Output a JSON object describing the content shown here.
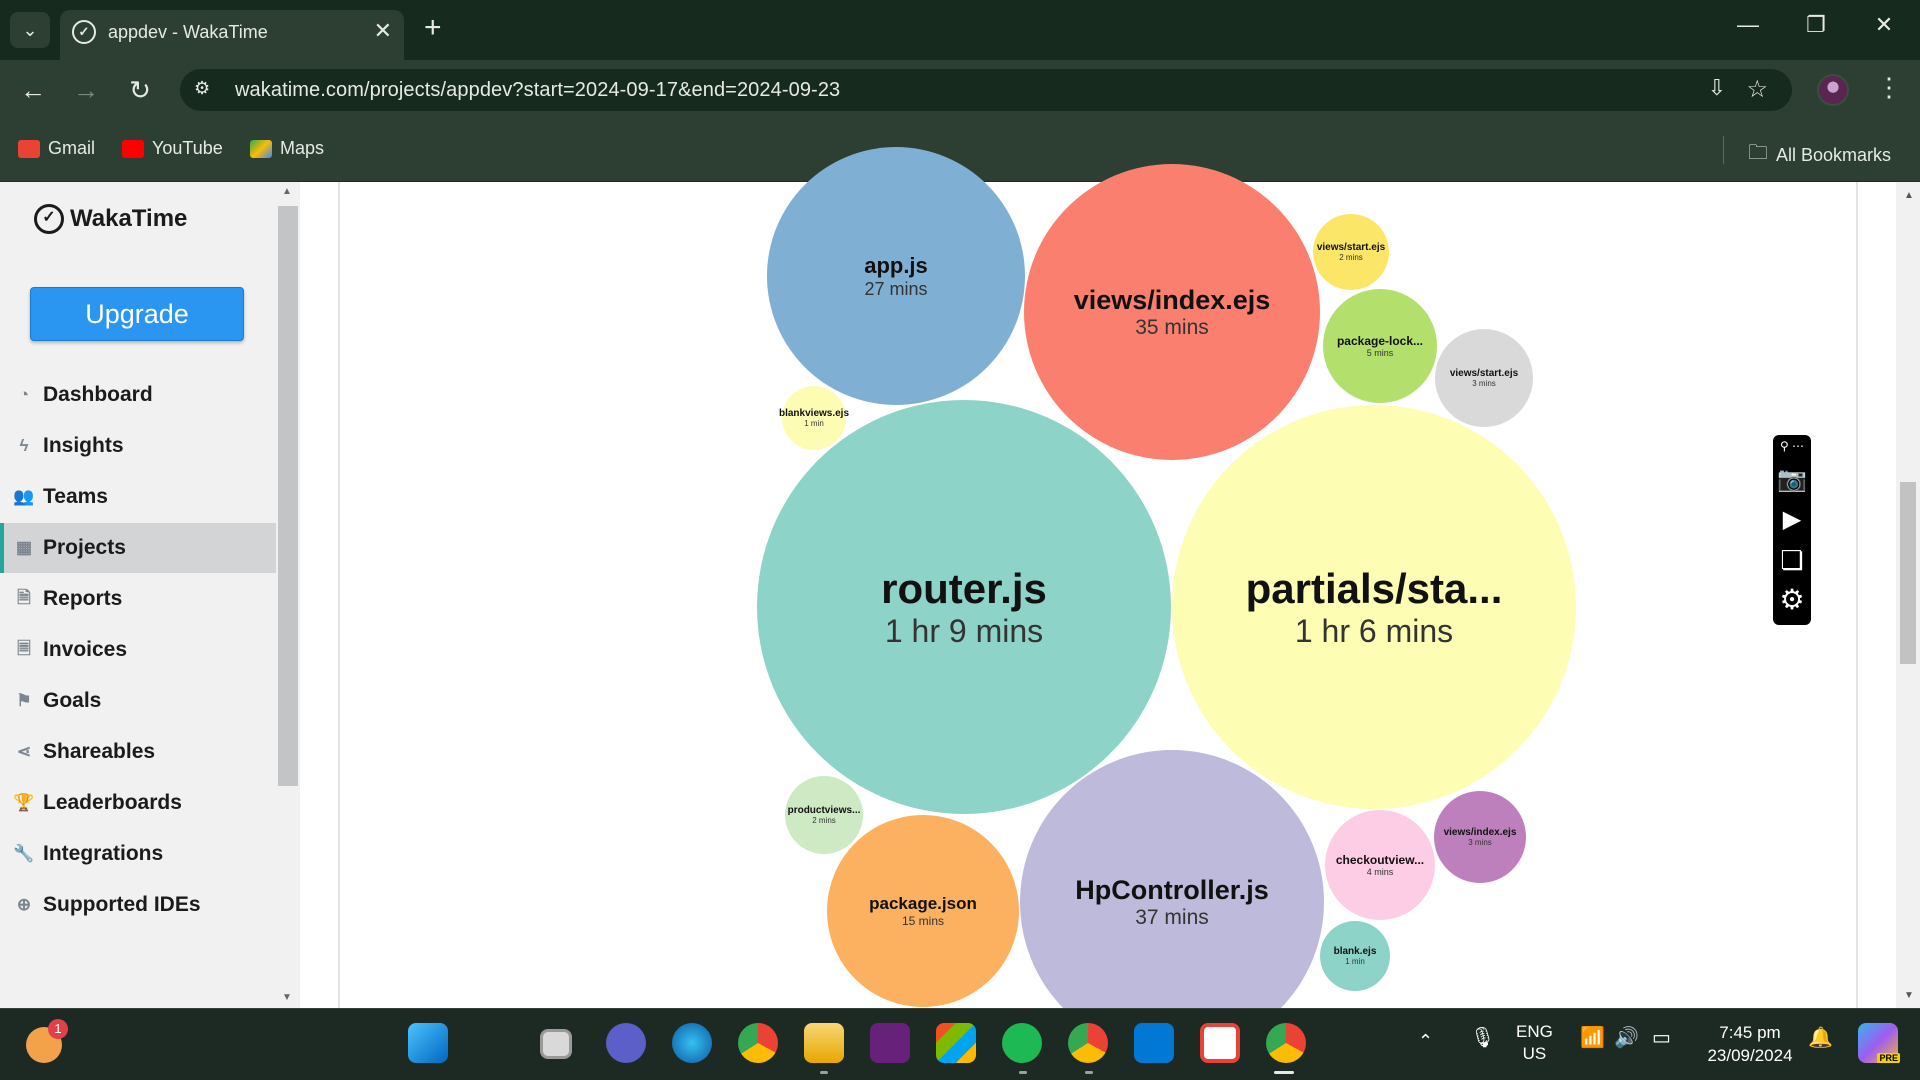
{
  "browser": {
    "tab_title": "appdev - WakaTime",
    "url": "wakatime.com/projects/appdev?start=2024-09-17&end=2024-09-23",
    "new_tab_symbol": "+",
    "close_tab_symbol": "✕",
    "bookmarks": [
      {
        "label": "Gmail",
        "color": "#ea4335"
      },
      {
        "label": "YouTube",
        "color": "#ff0000"
      },
      {
        "label": "Maps",
        "color": "#34a853"
      }
    ],
    "all_bookmarks": "All Bookmarks"
  },
  "sidebar": {
    "logo": "WakaTime",
    "upgrade_label": "Upgrade",
    "items": [
      {
        "label": "Dashboard",
        "icon": "dashboard-icon",
        "glyph": "◔"
      },
      {
        "label": "Insights",
        "icon": "lightning-icon",
        "glyph": "ϟ"
      },
      {
        "label": "Teams",
        "icon": "users-icon",
        "glyph": "👥"
      },
      {
        "label": "Projects",
        "icon": "grid-icon",
        "glyph": "▦"
      },
      {
        "label": "Reports",
        "icon": "report-file-icon",
        "glyph": "🗎"
      },
      {
        "label": "Invoices",
        "icon": "invoice-file-icon",
        "glyph": "🗏"
      },
      {
        "label": "Goals",
        "icon": "flag-icon",
        "glyph": "⚑"
      },
      {
        "label": "Shareables",
        "icon": "share-icon",
        "glyph": "⋖"
      },
      {
        "label": "Leaderboards",
        "icon": "trophy-icon",
        "glyph": "🏆"
      },
      {
        "label": "Integrations",
        "icon": "wrench-icon",
        "glyph": "🔧"
      },
      {
        "label": "Supported IDEs",
        "icon": "plus-circle-icon",
        "glyph": "⊕"
      }
    ],
    "active_item": "Projects"
  },
  "files_chart": {
    "bubbles": [
      {
        "name": "app.js",
        "duration": "27 mins",
        "color": "#80afd4"
      },
      {
        "name": "views/index.ejs",
        "duration": "35 mins",
        "color": "#fa7f6e"
      },
      {
        "name": "views/start.ejs",
        "duration": "2 mins",
        "color": "#fbe667"
      },
      {
        "name": "package-lock...",
        "duration": "5 mins",
        "color": "#b3e06c"
      },
      {
        "name": "views/start.ejs",
        "duration": "3 mins",
        "color": "#d9d9d9"
      },
      {
        "name": "blankviews.ejs",
        "duration": "1 min",
        "color": "#fcfcb2"
      },
      {
        "name": "router.js",
        "duration": "1 hr 9 mins",
        "color": "#8dd3c7"
      },
      {
        "name": "partials/sta...",
        "duration": "1 hr 6 mins",
        "color": "#fdfdb3"
      },
      {
        "name": "productviews...",
        "duration": "2 mins",
        "color": "#cdeac5"
      },
      {
        "name": "package.json",
        "duration": "15 mins",
        "color": "#fbb160"
      },
      {
        "name": "HpController.js",
        "duration": "37 mins",
        "color": "#bdbadb"
      },
      {
        "name": "checkoutview...",
        "duration": "4 mins",
        "color": "#fccde5"
      },
      {
        "name": "views/index.ejs",
        "duration": "3 mins",
        "color": "#bd80bd"
      },
      {
        "name": "blank.ejs",
        "duration": "1 min",
        "color": "#8ed3c7"
      }
    ]
  },
  "capture_toolbar": {
    "items": [
      "pin-icon",
      "camera-icon",
      "video-icon",
      "window-icon",
      "settings-icon"
    ]
  },
  "taskbar": {
    "weather_badge": "1",
    "apps": [
      "start-icon",
      "search-icon",
      "task-view-icon",
      "meet-icon",
      "edge-icon",
      "chrome-icon",
      "file-explorer-icon",
      "visual-studio-icon",
      "store-icon",
      "spotify-icon",
      "chrome-profile-icon",
      "vscode-icon",
      "gmail-icon",
      "chrome-active-icon"
    ],
    "lang_top": "ENG",
    "lang_bottom": "US",
    "time": "7:45 pm",
    "date": "23/09/2024",
    "copilot_badge": "PRE"
  }
}
